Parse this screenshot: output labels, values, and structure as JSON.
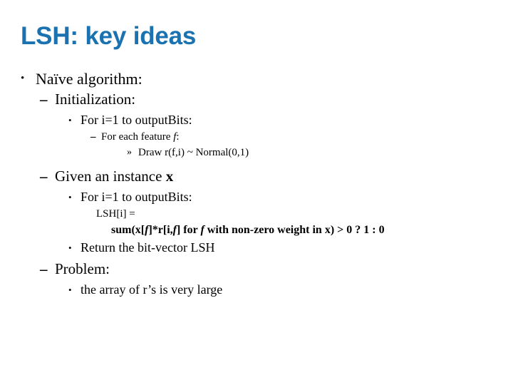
{
  "slide": {
    "title": "LSH: key ideas",
    "title_color": "#1a72b0",
    "background_color": "#ffffff",
    "text_color": "#000000"
  },
  "markers": {
    "bullet": "•",
    "dash": "–",
    "guillemet": "»"
  },
  "outline": {
    "naive_algorithm": "Naïve algorithm:",
    "initialization": "Initialization:",
    "for_i_outputbits_1": "For i=1 to outputBits:",
    "for_each_feature": "For each feature ",
    "for_each_feature_var": "f",
    "for_each_feature_tail": ":",
    "draw_r": "Draw r(f,i) ~ Normal(0,1)",
    "given_an_instance": "Given an instance ",
    "given_an_instance_var": "x",
    "for_i_outputbits_2": "For i=1 to outputBits:",
    "lsh_assign": "LSH[i] =",
    "formula": {
      "p1": "sum(",
      "x1": "x",
      "p2": "[",
      "f1": "f",
      "p3": "]*r[i,",
      "f2": "f",
      "p4": "] for ",
      "f3": "f",
      "p5": " with non-zero weight in ",
      "x2": "x",
      "p6": ") > 0 ? 1 : 0"
    },
    "return_bitvector": "Return the bit-vector LSH",
    "problem": "Problem:",
    "array_too_large": "the array of r’s is very large"
  }
}
